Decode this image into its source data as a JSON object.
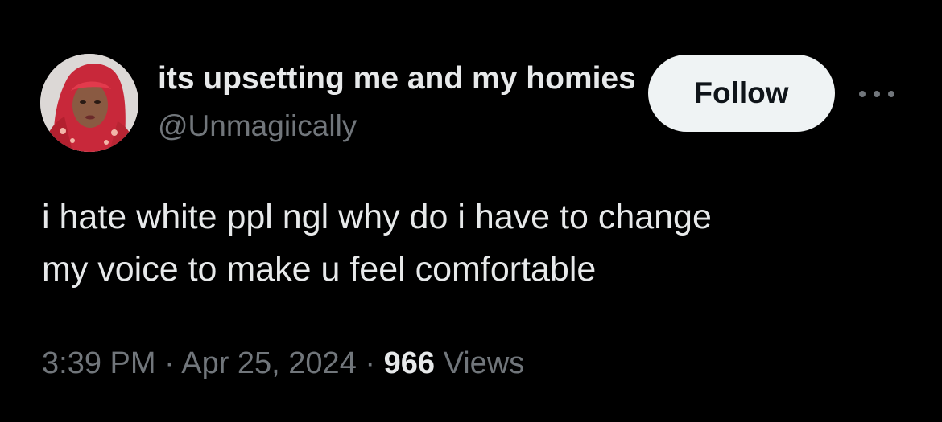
{
  "author": {
    "display_name": "its upsetting me and my homies",
    "handle": "@Unmagiically"
  },
  "actions": {
    "follow_label": "Follow",
    "more_icon": "more-horizontal-icon"
  },
  "tweet": {
    "lines": [
      "i hate white ppl ngl why do i have to change",
      "my voice to make u feel comfortable"
    ]
  },
  "meta": {
    "time": "3:39 PM",
    "separator": "·",
    "date": "Apr 25, 2024",
    "views_count": "966",
    "views_label": "Views"
  },
  "colors": {
    "background": "#000000",
    "primary_text": "#e7e9ea",
    "secondary_text": "#71767b",
    "follow_button_bg": "#eff3f4",
    "follow_button_text": "#0f1419"
  }
}
